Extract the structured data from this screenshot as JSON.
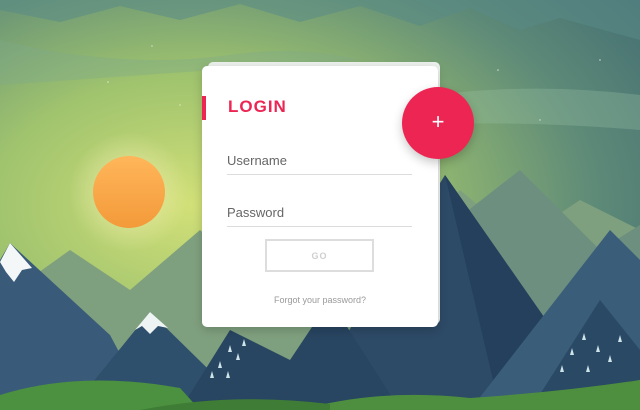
{
  "login_card": {
    "title": "LOGIN",
    "username_placeholder": "Username",
    "password_placeholder": "Password",
    "go_label": "GO",
    "forgot_link": "Forgot your password?"
  },
  "fab": {
    "icon": "plus-icon",
    "glyph": "+"
  },
  "colors": {
    "accent": "#ed2553",
    "sky_top": "#4f7b76",
    "sky_glow": "#c4dc72",
    "sun": "#f7a34a",
    "mountain_dark": "#2d4a66",
    "hill_green": "#4b9140"
  },
  "background": {
    "icon": "mountain-landscape-illustration"
  }
}
